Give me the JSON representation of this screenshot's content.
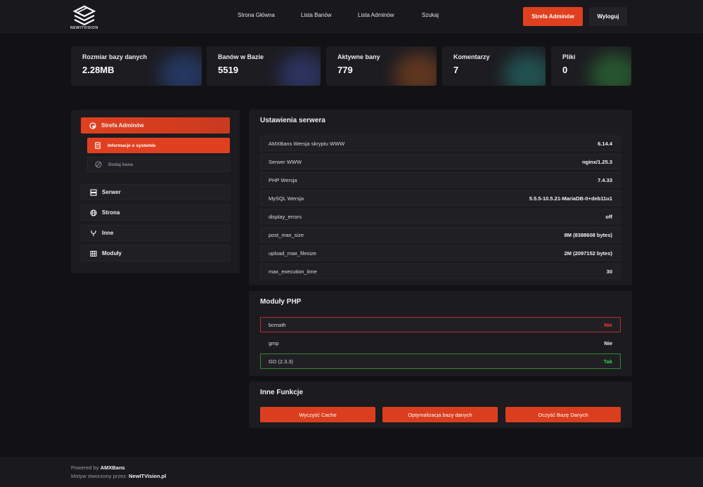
{
  "brand": {
    "logo_text": "NEWITVISION"
  },
  "nav": {
    "links": [
      "Strona Główna",
      "Lista Banów",
      "Lista Adminów",
      "Szukaj"
    ],
    "primary_button": "Strefa Adminów",
    "logout_button": "Wyloguj"
  },
  "stats": [
    {
      "label": "Rozmiar bazy danych",
      "value": "2.28MB",
      "glow": "#3a6cd8"
    },
    {
      "label": "Banów w Bazie",
      "value": "5519",
      "glow": "#4b5fd0"
    },
    {
      "label": "Aktywne bany",
      "value": "779",
      "glow": "#e06a1f"
    },
    {
      "label": "Komentarzy",
      "value": "7",
      "glow": "#2fb5a8"
    },
    {
      "label": "Pliki",
      "value": "0",
      "glow": "#3fc04a"
    }
  ],
  "sidebar": {
    "active": {
      "label": "Strefa Adminów",
      "icon": "shield-user-icon"
    },
    "sub_items": [
      {
        "label": "Informacje o systemie",
        "icon": "document-icon",
        "active": true
      },
      {
        "label": "Dodaj bana",
        "icon": "ban-icon",
        "active": false
      }
    ],
    "items": [
      {
        "label": "Serwer",
        "icon": "server-icon"
      },
      {
        "label": "Strona",
        "icon": "globe-icon"
      },
      {
        "label": "Inne",
        "icon": "fork-icon"
      },
      {
        "label": "Moduły",
        "icon": "grid-icon"
      }
    ]
  },
  "server_settings": {
    "title": "Ustawienia serwera",
    "rows": [
      {
        "key": "AMXBans Wersja skryptu WWW",
        "value": "6.14.4"
      },
      {
        "key": "Serwer WWW",
        "value": "nginx/1.25.3"
      },
      {
        "key": "PHP Wersja",
        "value": "7.4.33"
      },
      {
        "key": "MySQL Wersja",
        "value": "5.5.5-10.5.21-MariaDB-0+deb11u1"
      },
      {
        "key": "display_errors",
        "value": "off"
      },
      {
        "key": "post_max_size",
        "value": "8M (8388608 bytes)"
      },
      {
        "key": "upload_max_filesize",
        "value": "2M (2097152 bytes)"
      },
      {
        "key": "max_execution_time",
        "value": "30"
      }
    ]
  },
  "php_modules": {
    "title": "Moduły PHP",
    "rows": [
      {
        "key": "bcmath",
        "value": "Nie",
        "status": "bad"
      },
      {
        "key": "gmp",
        "value": "Nie",
        "status": "neutral"
      },
      {
        "key": "GD (2.3.3)",
        "value": "Tak",
        "status": "good"
      }
    ]
  },
  "other_functions": {
    "title": "Inne Funkcje",
    "buttons": [
      "Wyczyść Cache",
      "Optymalizacja bazy danych",
      "Oczyść Bazę Danych"
    ]
  },
  "footer": {
    "powered_prefix": "Powered by ",
    "powered_name": "AMXBans",
    "theme_prefix": "Motyw stworzony przez: ",
    "theme_author": "NewITVision.pl"
  },
  "colors": {
    "accent": "#e0401f",
    "background": "#121215",
    "panel": "#1b1b20",
    "bad": "#ff3b2e",
    "good": "#33d24a"
  }
}
